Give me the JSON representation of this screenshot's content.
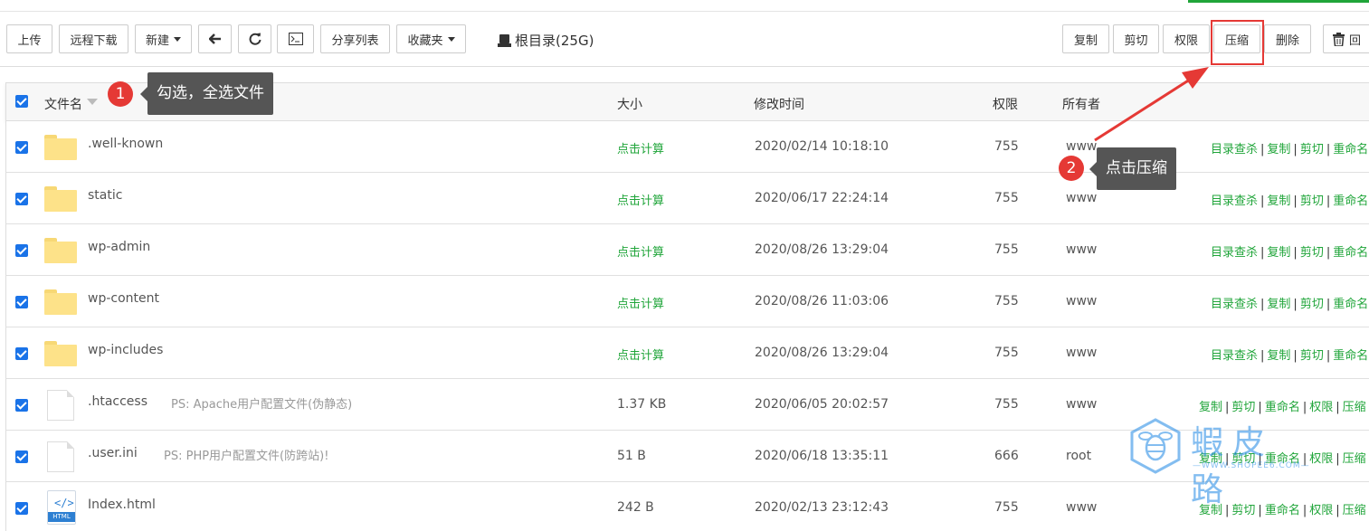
{
  "toolbar": {
    "upload": "上传",
    "remote_download": "远程下载",
    "new": "新建",
    "share_list": "分享列表",
    "favorites": "收藏夹",
    "root_dir": "根目录(25G)",
    "copy": "复制",
    "cut": "剪切",
    "permission": "权限",
    "compress": "压缩",
    "delete": "删除",
    "recycle": "回"
  },
  "table": {
    "headers": {
      "filename": "文件名",
      "size": "大小",
      "mtime": "修改时间",
      "perm": "权限",
      "owner": "所有者"
    },
    "rows": [
      {
        "name": ".well-known",
        "type": "folder",
        "ps": "",
        "size": "点击计算",
        "mtime": "2020/02/14 10:18:10",
        "perm": "755",
        "owner": "www"
      },
      {
        "name": "static",
        "type": "folder",
        "ps": "",
        "size": "点击计算",
        "mtime": "2020/06/17 22:24:14",
        "perm": "755",
        "owner": "www"
      },
      {
        "name": "wp-admin",
        "type": "folder",
        "ps": "",
        "size": "点击计算",
        "mtime": "2020/08/26 13:29:04",
        "perm": "755",
        "owner": "www"
      },
      {
        "name": "wp-content",
        "type": "folder",
        "ps": "",
        "size": "点击计算",
        "mtime": "2020/08/26 11:03:06",
        "perm": "755",
        "owner": "www"
      },
      {
        "name": "wp-includes",
        "type": "folder",
        "ps": "",
        "size": "点击计算",
        "mtime": "2020/08/26 13:29:04",
        "perm": "755",
        "owner": "www"
      },
      {
        "name": ".htaccess",
        "type": "file",
        "ps": "PS: Apache用户配置文件(伪静态)",
        "size": "1.37 KB",
        "mtime": "2020/06/05 20:02:57",
        "perm": "755",
        "owner": "www"
      },
      {
        "name": ".user.ini",
        "type": "file",
        "ps": "PS: PHP用户配置文件(防跨站)!",
        "size": "51 B",
        "mtime": "2020/06/18 13:35:11",
        "perm": "666",
        "owner": "root"
      },
      {
        "name": "Index.html",
        "type": "html",
        "ps": "",
        "size": "242 B",
        "mtime": "2020/02/13 23:12:43",
        "perm": "755",
        "owner": "www"
      }
    ],
    "folder_ops": [
      "目录查杀",
      "复制",
      "剪切",
      "重命名"
    ],
    "file_ops": [
      "复制",
      "剪切",
      "重命名",
      "权限",
      "压缩"
    ]
  },
  "annotations": {
    "step1_num": "1",
    "step1_text": "勾选，全选文件",
    "step2_num": "2",
    "step2_text": "点击压缩",
    "color_highlight": "#e53935"
  },
  "watermark": {
    "text": "蝦皮路",
    "sub": "—WWW.SHOPEE6.COM—"
  },
  "colors": {
    "accent_green": "#20a53a",
    "checkbox_blue": "#1a73e8",
    "folder_yellow": "#fde289"
  }
}
